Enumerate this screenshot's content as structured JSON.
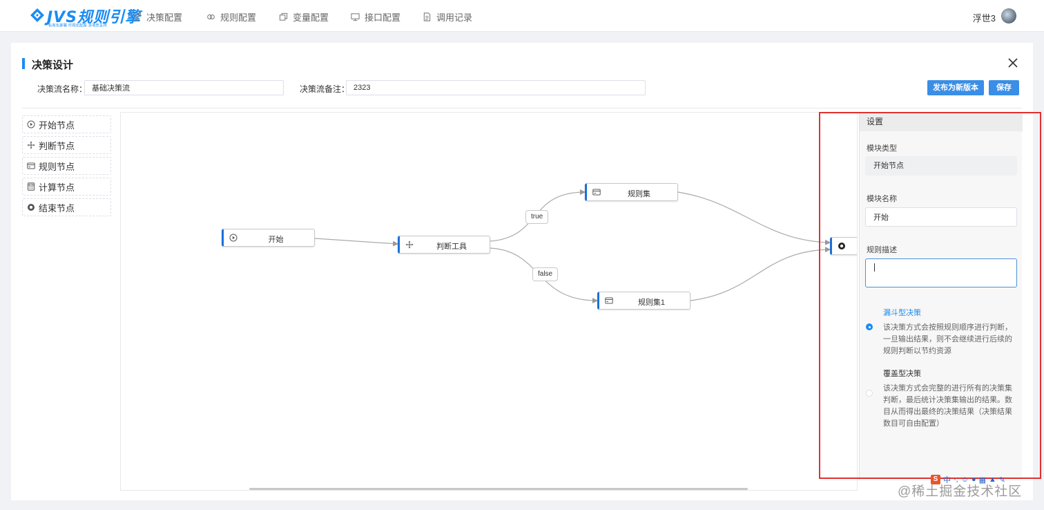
{
  "app": {
    "logo_text": "JVS规则引擎",
    "logo_subtitle": "私有化部署·可视化配置·多场景支持",
    "nav": [
      {
        "label": "决策配置",
        "icon": "branch-icon"
      },
      {
        "label": "规则配置",
        "icon": "link-icon"
      },
      {
        "label": "变量配置",
        "icon": "copy-icon"
      },
      {
        "label": "接口配置",
        "icon": "monitor-icon"
      },
      {
        "label": "调用记录",
        "icon": "document-icon"
      }
    ],
    "user": "浮世3"
  },
  "page": {
    "title": "决策设计",
    "flow_name_label": "决策流名称：",
    "flow_name_value": "基础决策流",
    "flow_remark_label": "决策流备注：",
    "flow_remark_value": "2323",
    "publish_button": "发布为新版本",
    "save_button": "保存"
  },
  "palette": [
    {
      "label": "开始节点",
      "icon": "play-circle-icon"
    },
    {
      "label": "判断节点",
      "icon": "move-icon"
    },
    {
      "label": "规则节点",
      "icon": "card-icon"
    },
    {
      "label": "计算节点",
      "icon": "calculator-icon"
    },
    {
      "label": "结束节点",
      "icon": "end-circle-icon"
    }
  ],
  "flow": {
    "nodes": [
      {
        "label": "开始",
        "icon": "play-circle-icon"
      },
      {
        "label": "判断工具",
        "icon": "move-icon"
      },
      {
        "label": "规则集",
        "icon": "card-icon"
      },
      {
        "label": "规则集1",
        "icon": "card-icon"
      },
      {
        "label": "",
        "icon": "end-circle-icon"
      }
    ],
    "edge_labels": [
      "true",
      "false"
    ]
  },
  "settings": {
    "header": "设置",
    "module_type_label": "模块类型",
    "module_type_value": "开始节点",
    "module_name_label": "模块名称",
    "module_name_value": "开始",
    "rule_desc_label": "规则描述",
    "rule_desc_value": "",
    "options": [
      {
        "title": "漏斗型决策",
        "desc": "该决策方式会按照规则顺序进行判断，一旦输出结果，则不会继续进行后续的规则判断以节约资源",
        "selected": true
      },
      {
        "title": "覆盖型决策",
        "desc": "该决策方式会完整的进行所有的决策集判断，最后统计决策集输出的结果。数目从而得出最终的决策结果（决策结果数目可自由配置）",
        "selected": false
      }
    ]
  },
  "colors": {
    "accent": "#1b8cf2",
    "highlight_border": "#e03030",
    "node_bar": "#1b6fd9"
  },
  "ime": {
    "brand": "S",
    "label": "中"
  },
  "watermark": "@稀土掘金技术社区"
}
